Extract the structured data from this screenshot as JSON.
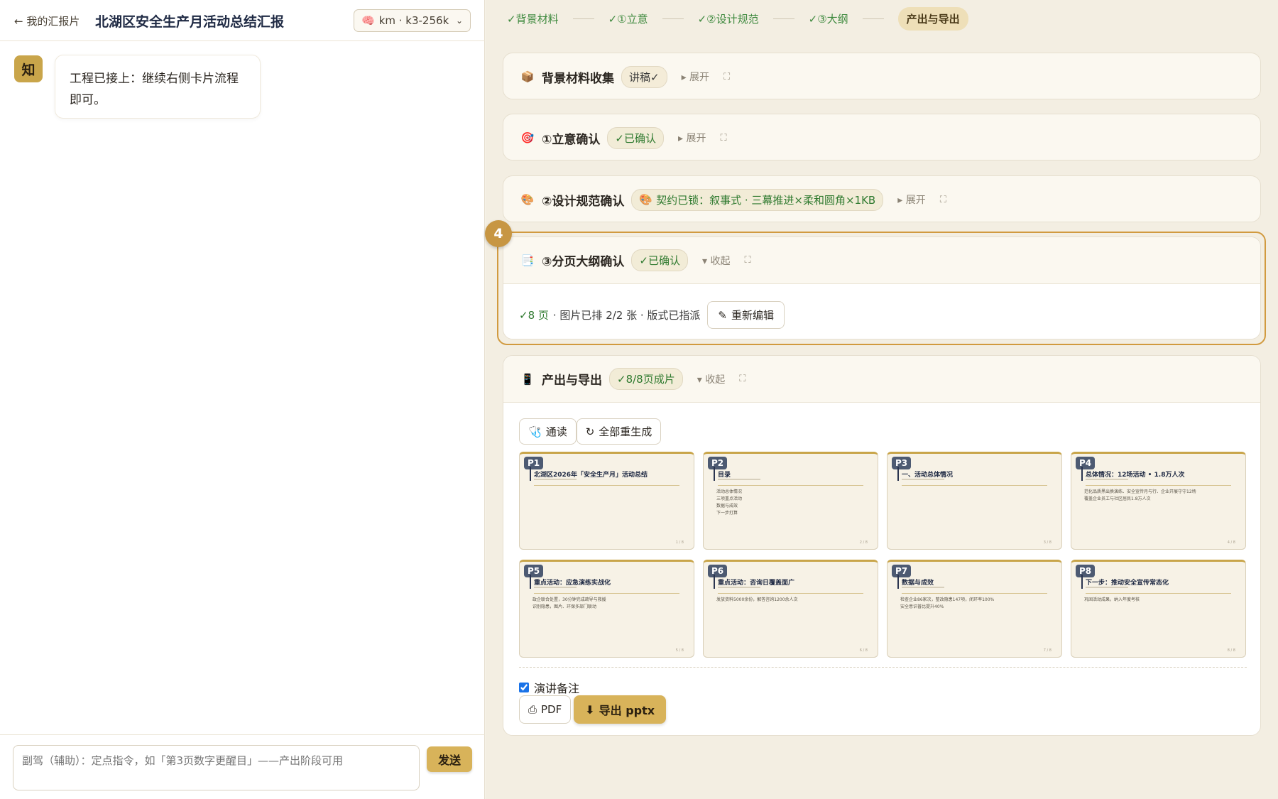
{
  "left": {
    "back_label": "← 我的汇报片",
    "title": "北湖区安全生产月活动总结汇报",
    "model": {
      "icon": "brain-icon",
      "value": "km · k3-256k"
    },
    "avatar_char": "知",
    "message": "工程已接上：继续右侧卡片流程即可。",
    "composer_placeholder": "副驾（辅助）：定点指令，如「第3页数字更醒目」——产出阶段可用",
    "send_label": "发送"
  },
  "stepper": [
    {
      "label": "✓背景材料"
    },
    {
      "label": "✓①立意"
    },
    {
      "label": "✓②设计规范"
    },
    {
      "label": "✓③大纲"
    },
    {
      "label": "产出与导出"
    }
  ],
  "cards": {
    "background": {
      "icon": "package-icon",
      "title": "背景材料收集",
      "badge": "讲稿✓",
      "toggle": "▸ 展开"
    },
    "intent": {
      "icon": "target-icon",
      "title": "①立意确认",
      "badge": "✓已确认",
      "toggle": "▸ 展开"
    },
    "design": {
      "icon": "palette-icon",
      "title": "②设计规范确认",
      "badge": "契约已锁：叙事式 · 三幕推进×柔和圆角×1KB",
      "toggle": "▸ 展开"
    },
    "outline": {
      "icon": "notepad-icon",
      "title": "③分页大纲确认",
      "badge": "✓已确认",
      "toggle": "▾ 收起",
      "step_number": "4",
      "summary_ok": "✓8 页",
      "summary_rest": " · 图片已排 2/2 张 · 版式已指派",
      "reedit_label": "重新编辑"
    },
    "export": {
      "icon": "phone-icon",
      "title": "产出与导出",
      "badge": "✓8/8页成片",
      "toggle": "▾ 收起",
      "read_label": "通读",
      "regen_label": "全部重生成",
      "notes_label": "演讲备注",
      "pdf_label": "PDF",
      "pptx_label": "导出 pptx"
    }
  },
  "slides": [
    {
      "no": "P1",
      "title": "北湖区2026年「安全生产月」活动总结",
      "lines": [],
      "page": "1 / 8"
    },
    {
      "no": "P2",
      "title": "目录",
      "lines": [
        "活动总体情况",
        "三项重点活动",
        "数据与成效",
        "下一步打算"
      ],
      "page": "2 / 8"
    },
    {
      "no": "P3",
      "title": "一、活动总体情况",
      "lines": [],
      "page": "3 / 8"
    },
    {
      "no": "P4",
      "title": "总体情况：12场活动 • 1.8万人次",
      "lines": [
        "范化品质黑出换演练、安全宣传月与行、企业开展守守12场",
        "覆盖企业员工与社区居民1.8万人次"
      ],
      "page": "4 / 8"
    },
    {
      "no": "P5",
      "title": "重点活动：应急演练实战化",
      "lines": [
        "政企联合处置，30分钟完成疏导与救援",
        "识别隐患，图片、环保多部门联动"
      ],
      "page": "5 / 8"
    },
    {
      "no": "P6",
      "title": "重点活动：咨询日覆盖面广",
      "lines": [
        "发放资料5000余份，解答咨询1200余人次"
      ],
      "page": "6 / 8"
    },
    {
      "no": "P7",
      "title": "数据与成效",
      "lines": [
        "检查企业86家次，整改隐患147项，闭环率100%",
        "安全意识普比提升40%"
      ],
      "page": "7 / 8"
    },
    {
      "no": "P8",
      "title": "下一步：推动安全宣传常态化",
      "lines": [
        "巩固活动成果，纳入年度考核"
      ],
      "page": "8 / 8"
    }
  ],
  "colors": {
    "accent": "#d8b35a",
    "ok_green": "#2f7a2f",
    "highlight": "#d19a3f",
    "slide_label": "#4d5a72"
  }
}
